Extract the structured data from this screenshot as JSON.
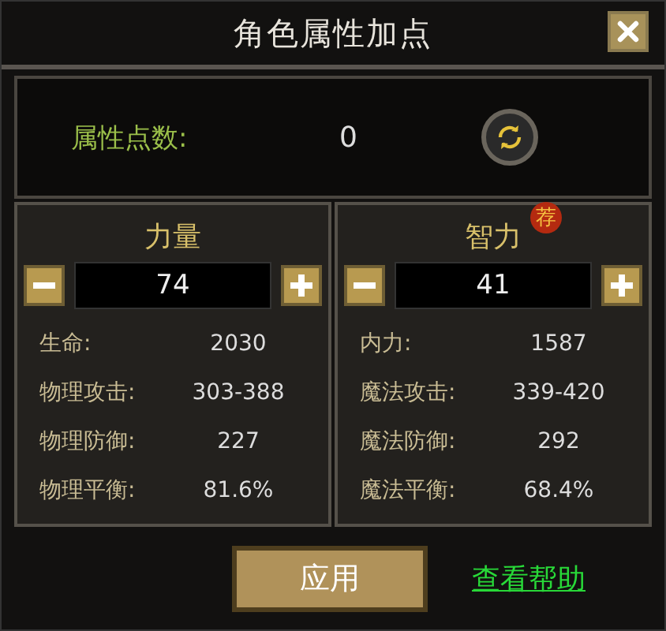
{
  "window": {
    "title": "角色属性加点"
  },
  "points": {
    "label": "属性点数:",
    "value": "0"
  },
  "attributes": [
    {
      "name": "力量",
      "value": "74",
      "stats": [
        {
          "label": "生命:",
          "value": "2030"
        },
        {
          "label": "物理攻击:",
          "value": "303-388"
        },
        {
          "label": "物理防御:",
          "value": "227"
        },
        {
          "label": "物理平衡:",
          "value": "81.6%"
        }
      ]
    },
    {
      "name": "智力",
      "value": "41",
      "badge": "荐",
      "stats": [
        {
          "label": "内力:",
          "value": "1587"
        },
        {
          "label": "魔法攻击:",
          "value": "339-420"
        },
        {
          "label": "魔法防御:",
          "value": "292"
        },
        {
          "label": "魔法平衡:",
          "value": "68.4%"
        }
      ]
    }
  ],
  "apply_button": "应用",
  "help_link": "查看帮助"
}
